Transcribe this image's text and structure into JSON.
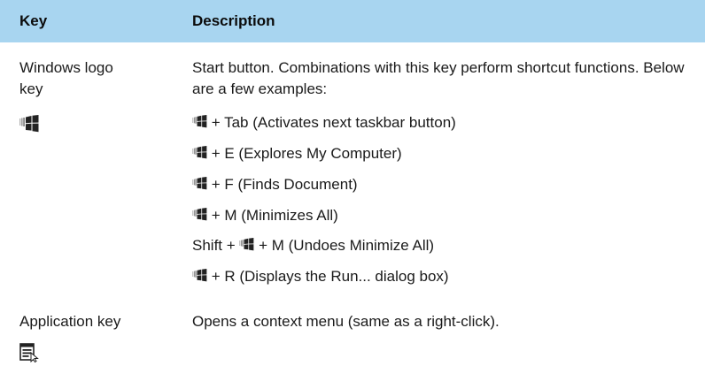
{
  "table": {
    "header": {
      "key": "Key",
      "description": "Description"
    },
    "rows": [
      {
        "key_line1": "Windows logo",
        "key_line2": "key",
        "key_icon": "windows-logo-icon",
        "intro": "Start button.  Combinations with this key perform shortcut functions.  Below are a few examples:",
        "examples": [
          {
            "prefix": "",
            "suffix": " + Tab (Activates next taskbar button)"
          },
          {
            "prefix": "",
            "suffix": " + E (Explores My Computer)"
          },
          {
            "prefix": "",
            "suffix": " + F (Finds Document)"
          },
          {
            "prefix": "",
            "suffix": " + M (Minimizes All)"
          },
          {
            "prefix": "Shift + ",
            "suffix": " + M (Undoes Minimize All)"
          },
          {
            "prefix": "",
            "suffix": " + R (Displays the Run... dialog box)"
          }
        ]
      },
      {
        "key_line1": "Application key",
        "key_icon": "application-key-icon",
        "description": "Opens a context menu (same as a right-click)."
      }
    ]
  },
  "colors": {
    "header_background": "#a8d5f0",
    "text": "#1a1a1a"
  }
}
